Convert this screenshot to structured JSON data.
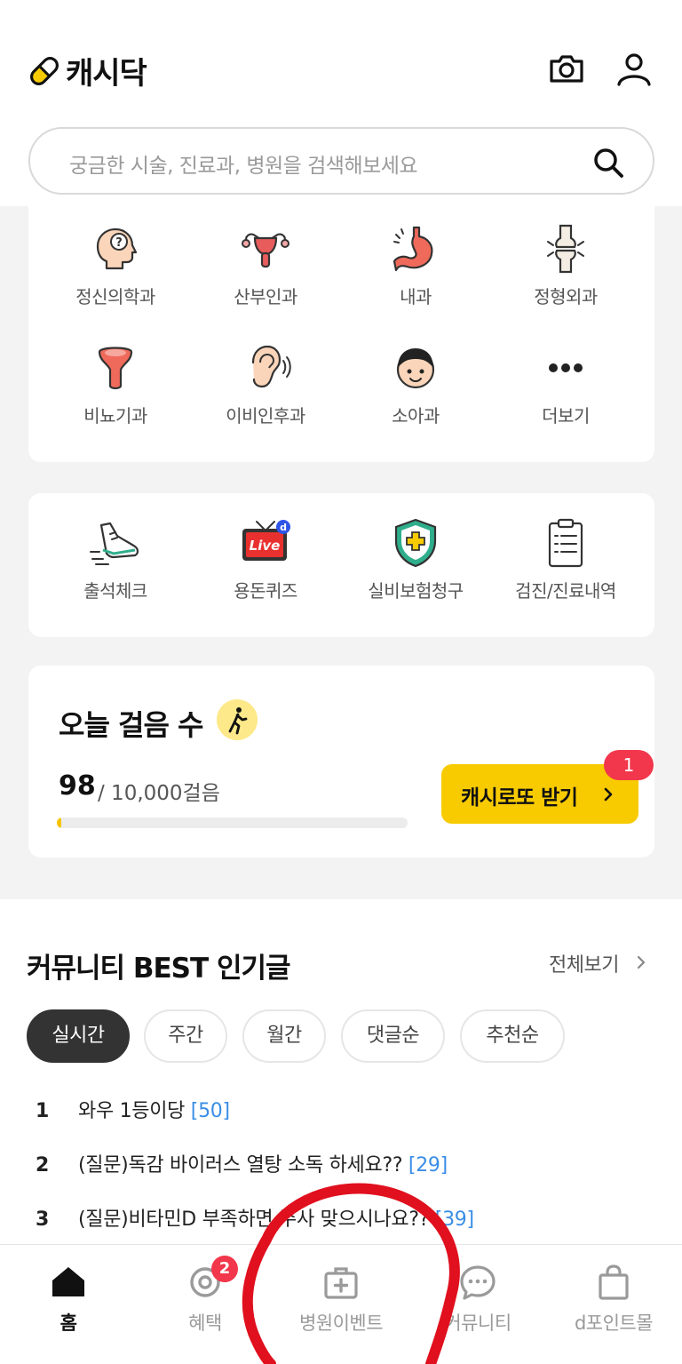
{
  "header": {
    "app_name": "캐시닥",
    "search_placeholder": "궁금한 시술, 진료과, 병원을 검색해보세요",
    "icons": [
      "camera-icon",
      "profile-icon",
      "search-icon"
    ]
  },
  "categories": [
    {
      "label": "정신의학과",
      "icon": "psychiatry-head-icon"
    },
    {
      "label": "산부인과",
      "icon": "uterus-icon"
    },
    {
      "label": "내과",
      "icon": "stomach-icon"
    },
    {
      "label": "정형외과",
      "icon": "bone-joint-icon"
    },
    {
      "label": "비뇨기과",
      "icon": "urology-icon"
    },
    {
      "label": "이비인후과",
      "icon": "ear-icon"
    },
    {
      "label": "소아과",
      "icon": "child-face-icon"
    },
    {
      "label": "더보기",
      "icon": "more-dots-icon"
    }
  ],
  "services": [
    {
      "label": "출석체크",
      "icon": "sneaker-icon"
    },
    {
      "label": "용돈퀴즈",
      "icon": "live-tv-icon"
    },
    {
      "label": "실비보험청구",
      "icon": "insurance-shield-icon"
    },
    {
      "label": "검진/진료내역",
      "icon": "clipboard-icon"
    }
  ],
  "steps": {
    "title": "오늘 걸음 수",
    "count": "98",
    "goal": "/ 10,000걸음",
    "progress_fraction": 0.0098,
    "button_label": "캐시로또 받기",
    "badge": "1"
  },
  "community": {
    "title": "커뮤니티 BEST 인기글",
    "view_all": "전체보기",
    "tabs": [
      "실시간",
      "주간",
      "월간",
      "댓글순",
      "추천순"
    ],
    "active_tab": 0,
    "posts": [
      {
        "rank": "1",
        "title": "와우 1등이당",
        "count": "[50]"
      },
      {
        "rank": "2",
        "title": "(질문)독감 바이러스 열탕 소독 하세요??",
        "count": "[29]"
      },
      {
        "rank": "3",
        "title": "(질문)비타민D 부족하면 주사 맞으시나요??",
        "count": "[39]"
      }
    ]
  },
  "bottom_nav": [
    {
      "label": "홈",
      "icon": "home-icon",
      "active": true
    },
    {
      "label": "혜택",
      "icon": "benefit-icon",
      "badge": "2"
    },
    {
      "label": "병원이벤트",
      "icon": "hospital-event-icon"
    },
    {
      "label": "커뮤니티",
      "icon": "chat-bubble-icon"
    },
    {
      "label": "d포인트몰",
      "icon": "shopping-bag-icon"
    }
  ],
  "colors": {
    "brand_yellow": "#f8cb00",
    "badge_red": "#f2364b",
    "link_blue": "#3a8ee6",
    "annotation_red": "#e0101e"
  }
}
